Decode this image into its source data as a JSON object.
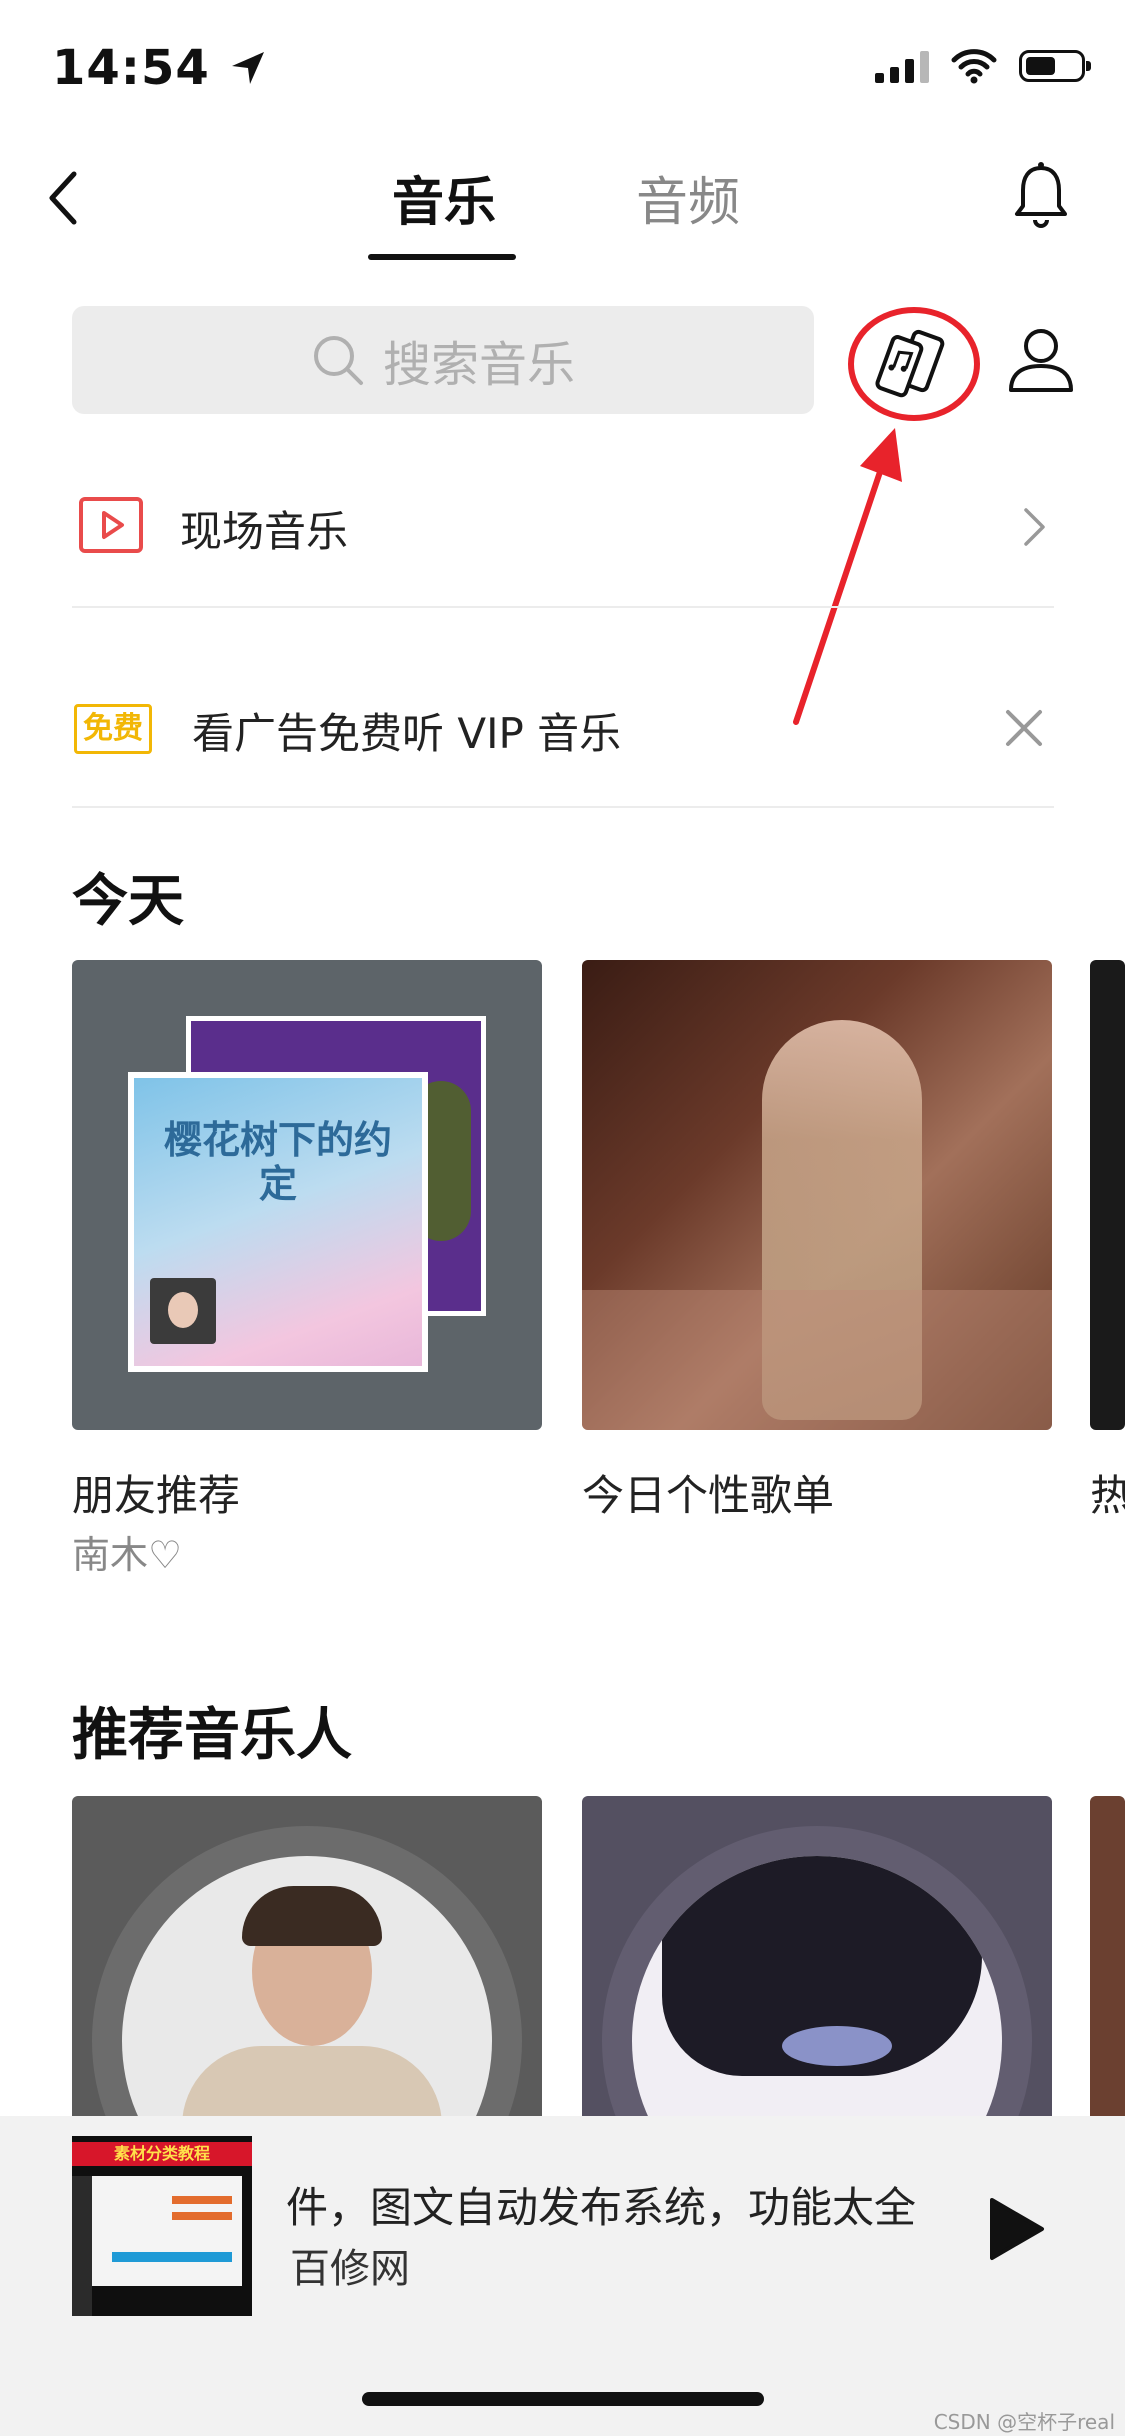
{
  "status_bar": {
    "time": "14:54",
    "battery_level": 0.55
  },
  "nav": {
    "tabs": [
      {
        "label": "音乐",
        "active": true
      },
      {
        "label": "音频",
        "active": false
      }
    ]
  },
  "search": {
    "placeholder": "搜索音乐"
  },
  "live_music": {
    "label": "现场音乐"
  },
  "ad_banner": {
    "badge": "免费",
    "text": "看广告免费听 VIP 音乐"
  },
  "today": {
    "title": "今天",
    "cards": [
      {
        "label": "朋友推荐",
        "sub": "南木♡",
        "art_text": "樱花树下的约定"
      },
      {
        "label": "今日个性歌单"
      },
      {
        "label": "热"
      }
    ]
  },
  "recommended_artists": {
    "title": "推荐音乐人"
  },
  "mini_player": {
    "thumb_text": "素材分类教程",
    "title": "件，图文自动发布系统，功能太全",
    "subtitle": "百修网"
  },
  "watermark": "CSDN @空杯子real",
  "colors": {
    "accent_red": "#e8232b",
    "badge_yellow": "#f2b705",
    "live_icon": "#e94b4b"
  }
}
